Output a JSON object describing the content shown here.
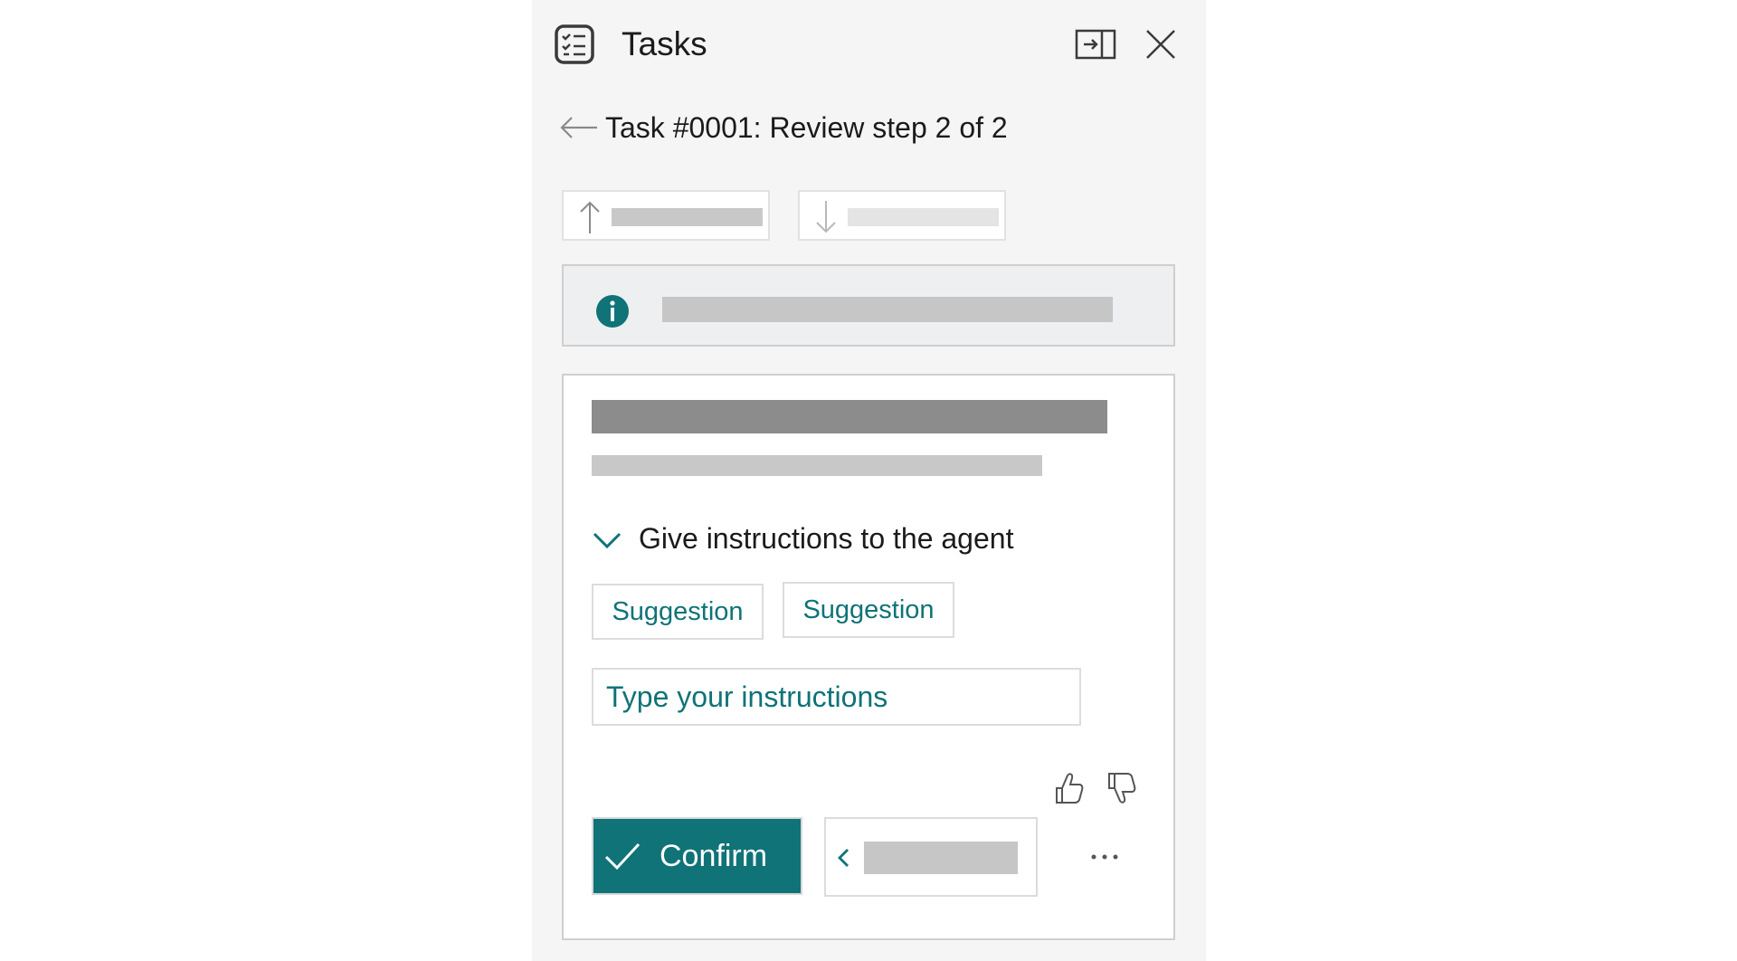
{
  "header": {
    "title": "Tasks",
    "icons": [
      "tasks-icon",
      "dock-panel-icon",
      "close-icon"
    ]
  },
  "breadcrumb": {
    "back_icon": "arrow-left-icon",
    "title": "Task #0001: Review step 2 of 2"
  },
  "navigation": {
    "previous_icon": "arrow-up-icon",
    "next_icon": "arrow-down-icon",
    "previous_enabled": true,
    "next_enabled": false
  },
  "info_banner": {
    "icon": "info-icon"
  },
  "card": {
    "instructions_section": {
      "label": "Give instructions to the agent",
      "expanded": true,
      "suggestions": [
        "Suggestion",
        "Suggestion"
      ],
      "input": {
        "value": "",
        "placeholder": "Type your instructions"
      }
    },
    "feedback": {
      "icons": [
        "thumbs-up-icon",
        "thumbs-down-icon"
      ]
    },
    "actions": {
      "confirm_label": "Confirm",
      "confirm_icon": "checkmark-icon",
      "back_icon": "chevron-left-icon",
      "more_icon": "more-options-icon"
    }
  },
  "colors": {
    "accent": "#0f7378",
    "panel_background": "#f5f5f5",
    "placeholder_bar": "#c6c6c6",
    "border": "#cfcfcf"
  }
}
